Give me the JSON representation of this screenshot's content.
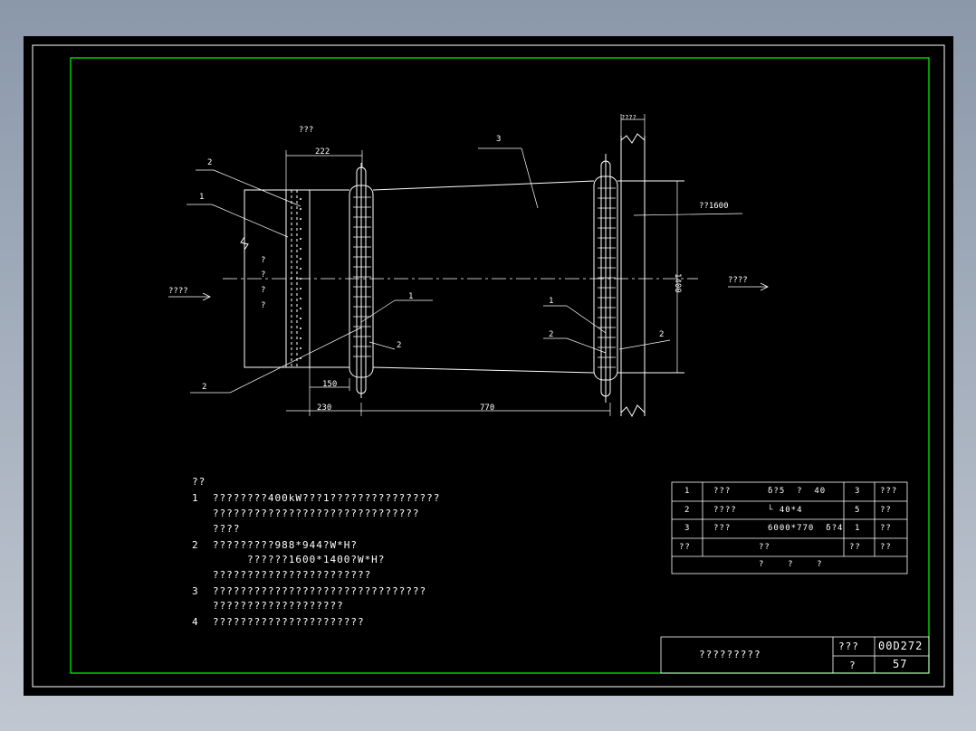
{
  "drawing": {
    "top_label": "???",
    "dim_222": "222",
    "dim_150": "150",
    "dim_230": "230",
    "dim_770": "770",
    "dim_1400": "1400",
    "dim_d1600": "??1600",
    "wall_label": "????",
    "inlet_label": "????",
    "outlet_label": "????",
    "item_1": "1",
    "item_2": "2",
    "item_3": "3",
    "q": "?"
  },
  "notes": {
    "heading": "??",
    "n1a": "1  ????????400kW???1????????????????",
    "n1b": "   ??????????????????????????????",
    "n1c": "   ????",
    "n2a": "2  ?????????988*944?W*H?",
    "n2b": "        ??????1600*1400?W*H?",
    "n2c": "   ???????????????????????",
    "n3a": "3  ???????????????????????????????",
    "n3b": "   ???????????????????",
    "n4": "4  ??????????????????????"
  },
  "bom": {
    "rows": [
      [
        "1",
        "???",
        "δ?5  ?  40",
        "3",
        "???"
      ],
      [
        "2",
        "????",
        "└ 40*4",
        "5",
        "??"
      ],
      [
        "3",
        "???",
        "6000*770  δ?4",
        "1",
        "??"
      ],
      [
        "??",
        "",
        "??",
        "??",
        "??"
      ]
    ],
    "footer": "?    ?    ?"
  },
  "title_block": {
    "title": "?????????",
    "label_a": "???",
    "code": "00D272",
    "label_b": "?",
    "page": "57"
  }
}
